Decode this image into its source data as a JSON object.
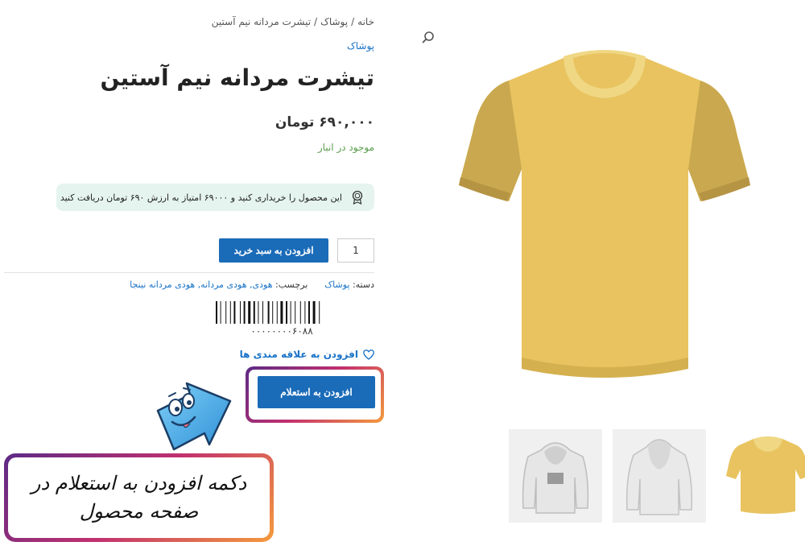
{
  "breadcrumb": {
    "items": [
      "خانه",
      "پوشاک",
      "تیشرت مردانه نیم آستین"
    ],
    "separator": "/"
  },
  "product": {
    "category": "پوشاک",
    "title": "تیشرت مردانه نیم آستین",
    "price": "۶۹۰,۰۰۰ تومان",
    "stock": "موجود در انبار",
    "points_notice": "این محصول را خریداری کنید و ۶۹۰۰۰ امتیاز به ارزش ۶۹۰ تومان دریافت کنید",
    "quantity": "1",
    "add_to_cart_label": "افزودن به سبد خرید",
    "meta": {
      "category_label": "دسته:",
      "category_value": "پوشاک",
      "tags_label": "برچسب:",
      "tags_value": "هودی, هودی مردانه, هودی مردانه نینجا"
    },
    "barcode_number": "۰۰۰۰۰۰۰۰۶۰۸۸",
    "wishlist_label": "افزودن به علاقه مندی ها",
    "inquiry_label": "افزودن به استعلام"
  },
  "callout": {
    "line1": "دکمه افزودن به استعلام در",
    "line2": "صفحه محصول"
  },
  "colors": {
    "accent": "#1a6bb8",
    "link": "#1a73c7",
    "stock": "#5a9d4b",
    "notice_bg": "#e5f4ef",
    "shirt": "#e8c35f"
  },
  "icons": {
    "search": "search-icon",
    "points": "award-icon",
    "wishlist": "heart-icon"
  }
}
